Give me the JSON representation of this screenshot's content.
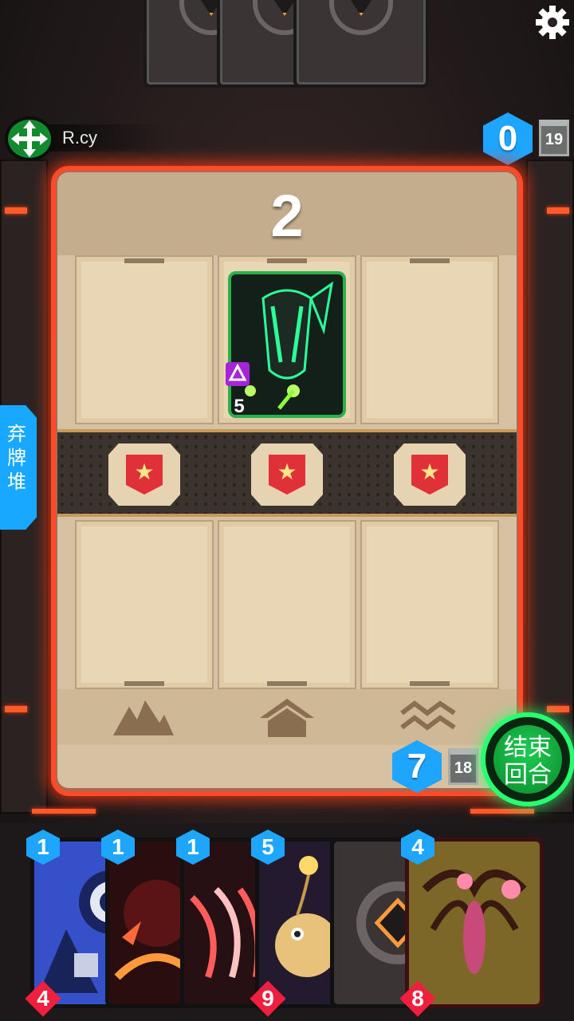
{
  "colors": {
    "energy": "#1ea6ff",
    "power": "#ef1f3d",
    "board_glow": "#ff4a2a",
    "end_turn": "#27ff70",
    "opponent_card_border": "#2bb04a"
  },
  "icons": {
    "settings": "gear-icon",
    "opponent_avatar": "move-arrows-icon",
    "lane_badge": "star-flag-icon",
    "terrain_left": "mountains-icon",
    "terrain_mid": "house-icon",
    "terrain_right": "waves-icon"
  },
  "opponent": {
    "name": "R.cy",
    "energy": "0",
    "deck_count": "19",
    "played_card": {
      "power": "5"
    }
  },
  "board": {
    "turn": "2"
  },
  "discard_label": "弃牌堆",
  "end_turn_label": "结束回合",
  "player": {
    "energy": "7",
    "deck_count": "18"
  },
  "hand": [
    {
      "cost": "1",
      "power": "4"
    },
    {
      "cost": "1"
    },
    {
      "cost": "1"
    },
    {
      "cost": "5",
      "power": "9"
    },
    {
      "cost": "4",
      "power": "8"
    }
  ]
}
